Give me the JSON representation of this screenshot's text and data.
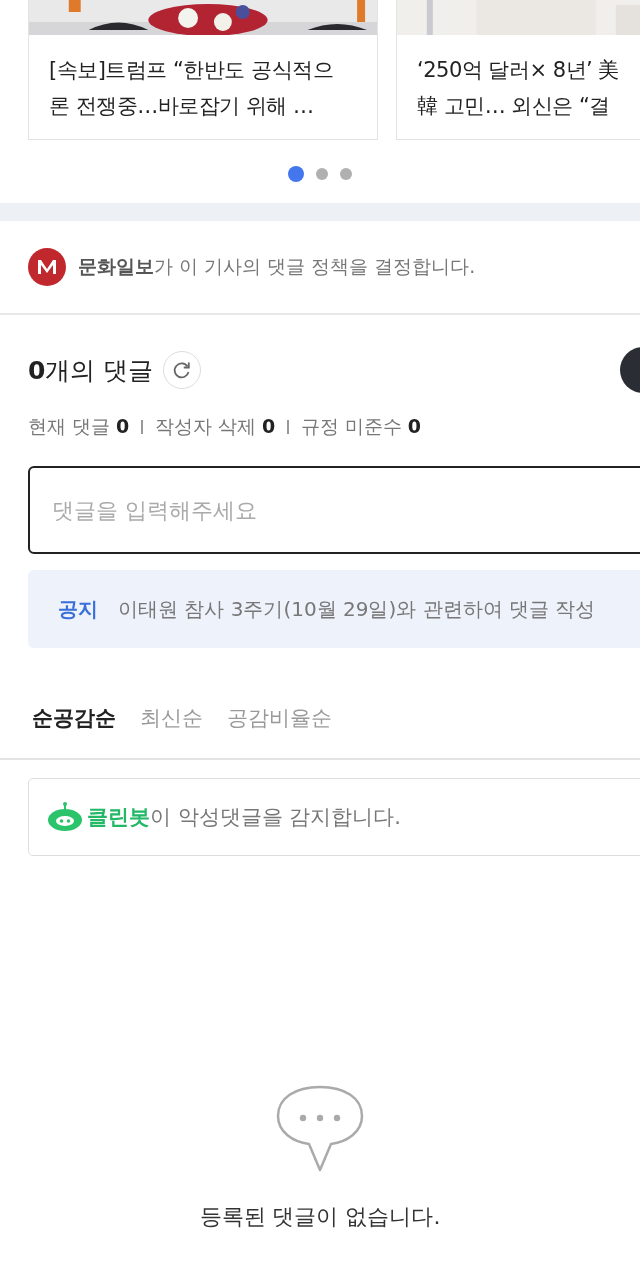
{
  "related_articles": [
    {
      "kind": "picture",
      "title_lines": [
        "[속보]트럼프 “한반도 공식적으",
        "론 전쟁중…바로잡기 위해 …"
      ]
    },
    {
      "kind": "picture",
      "title_lines": [
        "‘250억 달러× 8년’ 美",
        "韓 고민… 외신은 “결"
      ]
    }
  ],
  "carousel_dots": [
    {
      "selected": true
    },
    {
      "selected": false
    },
    {
      "selected": false
    }
  ],
  "policy": {
    "publisher": "문화일보",
    "text": "가 이 기사의 댓글 정책을 결정합니다."
  },
  "comments_header": {
    "count": "0",
    "label": "개의 댓글"
  },
  "stats": [
    {
      "label": "현재 댓글",
      "value": "0"
    },
    {
      "label": "작성자 삭제",
      "value": "0"
    },
    {
      "label": "규정 미준수",
      "value": "0"
    }
  ],
  "comment_input": {
    "placeholder": "댓글을 입력해주세요"
  },
  "notice": {
    "tag": "공지",
    "text": "이태원 참사 3주기(10월 29일)와 관련하여 댓글 작성"
  },
  "sort_tabs": [
    {
      "label": "순공감순",
      "selected": true
    },
    {
      "label": "최신순",
      "selected": false
    },
    {
      "label": "공감비율순",
      "selected": false
    }
  ],
  "cleanbot": {
    "name": "클린봇",
    "text": "이 악성댓글을 감지합니다."
  },
  "empty_message": "등록된 댓글이 없습니다."
}
